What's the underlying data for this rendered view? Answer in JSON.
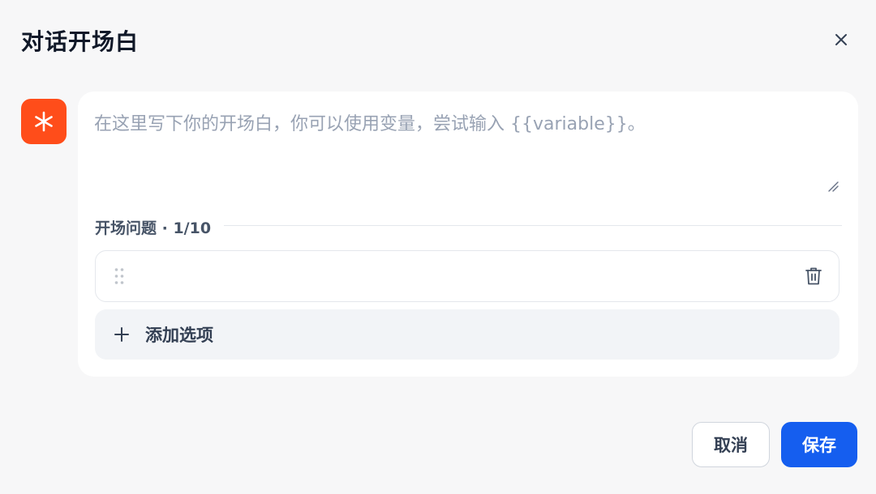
{
  "dialog": {
    "title": "对话开场白",
    "close_icon": "close-icon"
  },
  "editor": {
    "avatar_icon": "asterisk-icon",
    "avatar_color": "#ff4d1a",
    "opening_text": "",
    "placeholder": "在这里写下你的开场白，你可以使用变量，尝试输入 {{variable}}。"
  },
  "questions": {
    "label": "开场问题 · 1/10",
    "items": [
      {
        "value": "",
        "placeholder": ""
      }
    ],
    "add_label": "添加选项"
  },
  "footer": {
    "cancel_label": "取消",
    "save_label": "保存",
    "accent_color": "#155eef"
  }
}
